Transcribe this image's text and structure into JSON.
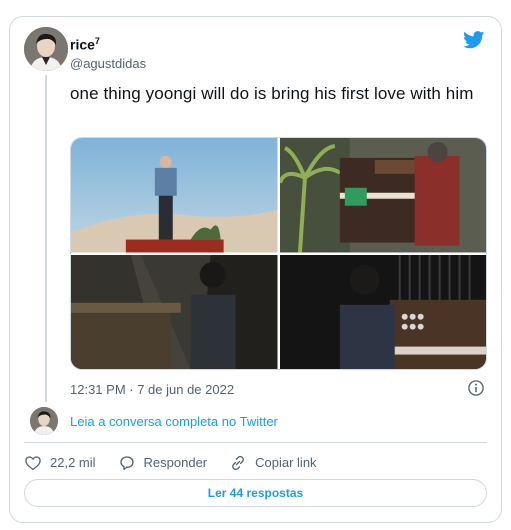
{
  "tweet": {
    "author": {
      "name": "rice",
      "badge": "7",
      "handle": "@agustdidas"
    },
    "text": "one thing yoongi will do is bring his first love with him",
    "timestamp": "12:31 PM · 7 de jun de 2022",
    "media_count": 4
  },
  "conversation": {
    "link_text": "Leia a conversa completa no Twitter"
  },
  "actions": {
    "likes": "22,2 mil",
    "reply_label": "Responder",
    "copy_label": "Copiar link"
  },
  "read_replies_label": "Ler 44 respostas",
  "colors": {
    "accent": "#1d9bf0",
    "secondary_text": "#536471",
    "border": "#cfd9de"
  },
  "icons": [
    "twitter-bird-icon",
    "info-icon",
    "heart-icon",
    "reply-icon",
    "link-icon"
  ]
}
